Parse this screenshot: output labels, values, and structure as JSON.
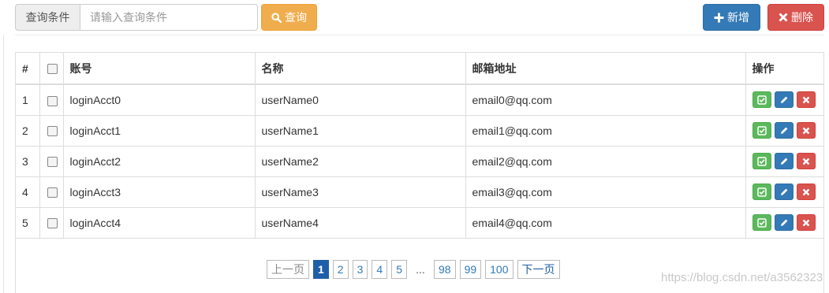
{
  "search": {
    "addon_label": "查询条件",
    "placeholder": "请输入查询条件",
    "value": "",
    "query_label": "查询"
  },
  "actions": {
    "add_label": "新增",
    "delete_label": "删除"
  },
  "table": {
    "headers": {
      "index": "#",
      "account": "账号",
      "name": "名称",
      "email": "邮箱地址",
      "ops": "操作"
    },
    "rows": [
      {
        "index": "1",
        "account": "loginAcct0",
        "name": "userName0",
        "email": "email0@qq.com"
      },
      {
        "index": "2",
        "account": "loginAcct1",
        "name": "userName1",
        "email": "email1@qq.com"
      },
      {
        "index": "3",
        "account": "loginAcct2",
        "name": "userName2",
        "email": "email2@qq.com"
      },
      {
        "index": "4",
        "account": "loginAcct3",
        "name": "userName3",
        "email": "email3@qq.com"
      },
      {
        "index": "5",
        "account": "loginAcct4",
        "name": "userName4",
        "email": "email4@qq.com"
      }
    ]
  },
  "pagination": {
    "prev": "上一页",
    "pages": [
      "1",
      "2",
      "3",
      "4",
      "5"
    ],
    "ellipsis": "...",
    "tail_pages": [
      "98",
      "99",
      "100"
    ],
    "next": "下一页",
    "current": "1"
  },
  "watermark": "https://blog.csdn.net/a3562323",
  "colors": {
    "query": "#f0ad4e",
    "add": "#337ab7",
    "delete": "#d9534f",
    "check": "#5cb85c",
    "edit": "#337ab7",
    "remove": "#d9534f",
    "page_active": "#1f5fa8"
  },
  "icons": {
    "query": "search-icon",
    "add": "plus-icon",
    "delete": "remove-icon",
    "row_check": "check-square-icon",
    "row_edit": "pencil-icon",
    "row_remove": "remove-icon"
  }
}
